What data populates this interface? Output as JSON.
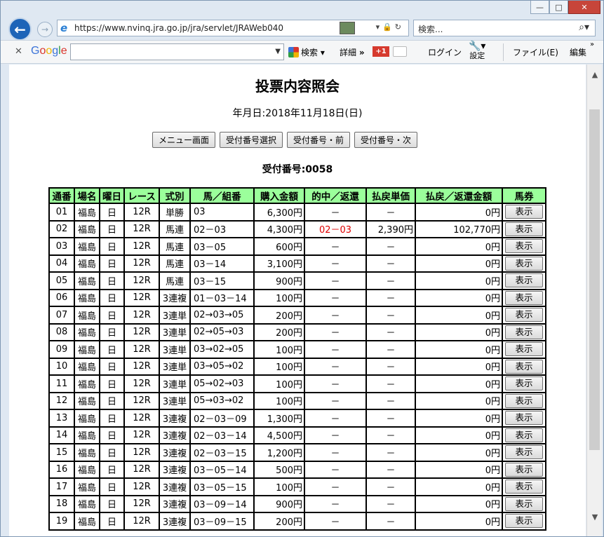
{
  "browser": {
    "url": "https://www.nvinq.jra.go.jp/jra/servlet/JRAWeb040",
    "search_placeholder": "検索...",
    "window_controls": [
      "minimize-icon",
      "maximize-icon",
      "close-icon"
    ],
    "google_bar": {
      "logo": [
        "G",
        "o",
        "o",
        "g",
        "l",
        "e"
      ],
      "search_label": "検索",
      "details_label": "詳細",
      "gplus_label": "+1",
      "login_label": "ログイン",
      "settings_label": "設定",
      "file_menu": "ファイル(E)",
      "edit_menu": "編集"
    }
  },
  "page": {
    "title": "投票内容照会",
    "date_line": "年月日:2018年11月18日(日)",
    "buttons": [
      "メニュー画面",
      "受付番号選択",
      "受付番号・前",
      "受付番号・次"
    ],
    "receipt_number": "受付番号:0058"
  },
  "table": {
    "headers": [
      "通番",
      "場名",
      "曜日",
      "レース",
      "式別",
      "馬／組番",
      "購入金額",
      "的中／返還",
      "払戻単価",
      "払戻／返還金額",
      "馬券"
    ],
    "show_label": "表示",
    "rows": [
      [
        "01",
        "福島",
        "日",
        "12R",
        "単勝",
        "03",
        "6,300円",
        "－",
        "－",
        "0円"
      ],
      [
        "02",
        "福島",
        "日",
        "12R",
        "馬連",
        "02－03",
        "4,300円",
        "02－03",
        "2,390円",
        "102,770円"
      ],
      [
        "03",
        "福島",
        "日",
        "12R",
        "馬連",
        "03－05",
        "600円",
        "－",
        "－",
        "0円"
      ],
      [
        "04",
        "福島",
        "日",
        "12R",
        "馬連",
        "03－14",
        "3,100円",
        "－",
        "－",
        "0円"
      ],
      [
        "05",
        "福島",
        "日",
        "12R",
        "馬連",
        "03－15",
        "900円",
        "－",
        "－",
        "0円"
      ],
      [
        "06",
        "福島",
        "日",
        "12R",
        "3連複",
        "01－03－14",
        "100円",
        "－",
        "－",
        "0円"
      ],
      [
        "07",
        "福島",
        "日",
        "12R",
        "3連単",
        "02→03→05",
        "200円",
        "－",
        "－",
        "0円"
      ],
      [
        "08",
        "福島",
        "日",
        "12R",
        "3連単",
        "02→05→03",
        "200円",
        "－",
        "－",
        "0円"
      ],
      [
        "09",
        "福島",
        "日",
        "12R",
        "3連単",
        "03→02→05",
        "100円",
        "－",
        "－",
        "0円"
      ],
      [
        "10",
        "福島",
        "日",
        "12R",
        "3連単",
        "03→05→02",
        "100円",
        "－",
        "－",
        "0円"
      ],
      [
        "11",
        "福島",
        "日",
        "12R",
        "3連単",
        "05→02→03",
        "100円",
        "－",
        "－",
        "0円"
      ],
      [
        "12",
        "福島",
        "日",
        "12R",
        "3連単",
        "05→03→02",
        "100円",
        "－",
        "－",
        "0円"
      ],
      [
        "13",
        "福島",
        "日",
        "12R",
        "3連複",
        "02－03－09",
        "1,300円",
        "－",
        "－",
        "0円"
      ],
      [
        "14",
        "福島",
        "日",
        "12R",
        "3連複",
        "02－03－14",
        "4,500円",
        "－",
        "－",
        "0円"
      ],
      [
        "15",
        "福島",
        "日",
        "12R",
        "3連複",
        "02－03－15",
        "1,200円",
        "－",
        "－",
        "0円"
      ],
      [
        "16",
        "福島",
        "日",
        "12R",
        "3連複",
        "03－05－14",
        "500円",
        "－",
        "－",
        "0円"
      ],
      [
        "17",
        "福島",
        "日",
        "12R",
        "3連複",
        "03－05－15",
        "100円",
        "－",
        "－",
        "0円"
      ],
      [
        "18",
        "福島",
        "日",
        "12R",
        "3連複",
        "03－09－14",
        "900円",
        "－",
        "－",
        "0円"
      ],
      [
        "19",
        "福島",
        "日",
        "12R",
        "3連複",
        "03－09－15",
        "200円",
        "－",
        "－",
        "0円"
      ]
    ],
    "hit_color": "#e00000",
    "header_color": "#9bff9b"
  }
}
